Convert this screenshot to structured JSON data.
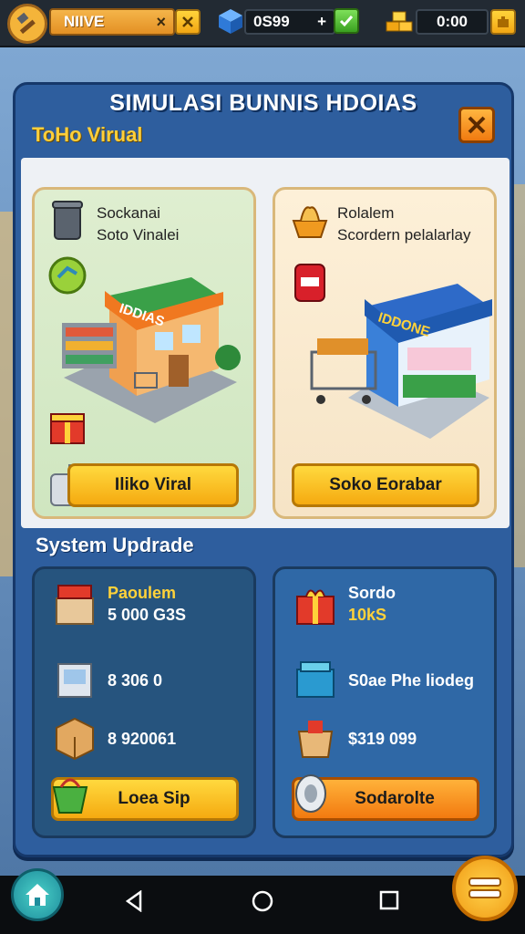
{
  "topbar": {
    "name_value": "NIIVE",
    "name_clear": "×",
    "gems": "0S99",
    "gems_plus": "+",
    "gold": "0:00"
  },
  "panel": {
    "title": "SIMULASI BUNNIS HDOIAS",
    "subtitle": "ToHo Virual"
  },
  "cards": [
    {
      "line1": "Sockanai",
      "line2": "Soto Vinalei",
      "sign": "IDDIAS",
      "button": "Iliko Viral"
    },
    {
      "line1": "Rolalem",
      "line2": "Scordern pelalarlay",
      "sign": "IDDONE",
      "button": "Soko Eorabar"
    }
  ],
  "section_title": "System Updrade",
  "updates": [
    {
      "rows": [
        {
          "label": "Paoulem",
          "value": "5 000 G3S"
        },
        {
          "label": "",
          "value": "8 306  0"
        },
        {
          "label": "",
          "value": "8 920061"
        }
      ],
      "button": "Loea Sip"
    },
    {
      "rows": [
        {
          "label": "Sordo",
          "value": "10kS"
        },
        {
          "label": "",
          "value": "S0ae Phe liodeg"
        },
        {
          "label": "",
          "value": "$319 099"
        }
      ],
      "button": "Sodarolte"
    }
  ],
  "colors": {
    "accent": "#f5aa10",
    "panel": "#2e5e9e",
    "title_yellow": "#ffcf3a"
  },
  "icons": [
    "home-icon",
    "menu-icon",
    "back-nav-icon",
    "home-nav-icon",
    "recents-nav-icon"
  ]
}
